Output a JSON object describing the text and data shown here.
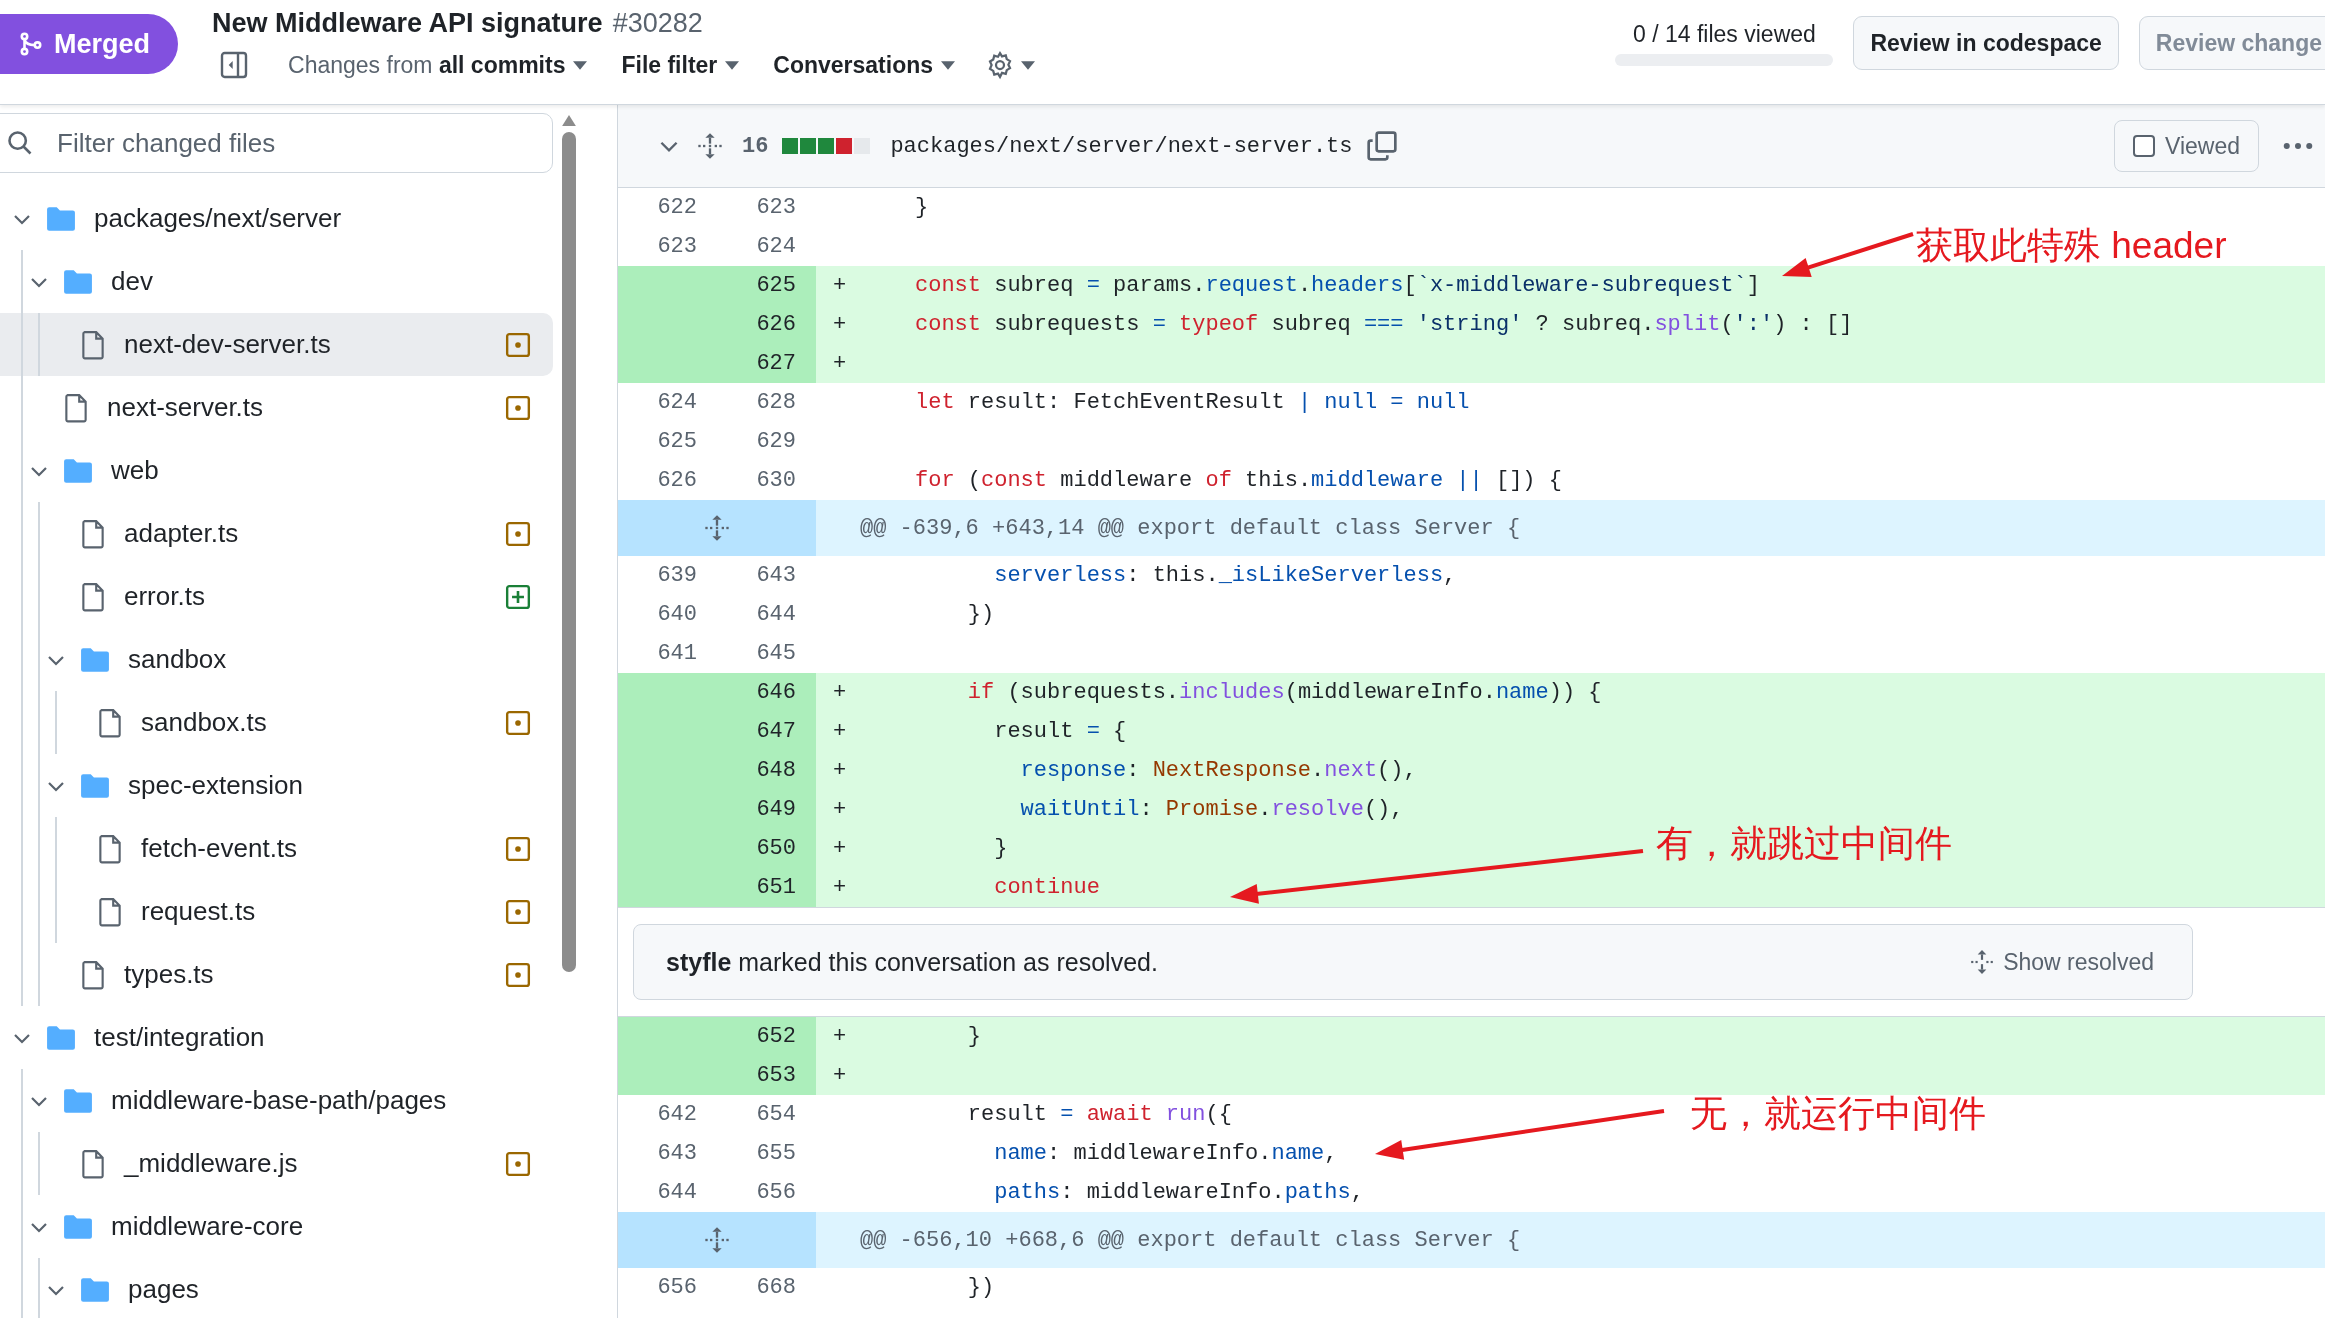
{
  "header": {
    "badge": {
      "kind": "merged",
      "label": "Merged"
    },
    "title": "New Middleware API signature",
    "number": "#30282",
    "filters": [
      {
        "label": "Changes from",
        "value": "all commits"
      },
      {
        "label": "File filter"
      },
      {
        "label": "Conversations"
      }
    ],
    "progress": {
      "text": "0 / 14 files viewed",
      "level": 0
    },
    "buttons": [
      {
        "label": "Review in codespace",
        "disabled": false
      },
      {
        "label": "Review change",
        "disabled": true
      }
    ]
  },
  "sidebar": {
    "search": {
      "placeholder": "Filter changed files"
    },
    "tree": [
      {
        "name": "packages/next/server",
        "kind": "folder",
        "expanded": true,
        "selected": false,
        "children": [
          {
            "name": "dev",
            "kind": "folder",
            "expanded": true,
            "selected": false,
            "children": [
              {
                "name": "next-dev-server.ts",
                "kind": "modified",
                "selected": true
              }
            ]
          },
          {
            "name": "next-server.ts",
            "kind": "modified",
            "selected": false
          },
          {
            "name": "web",
            "kind": "folder",
            "expanded": true,
            "selected": false,
            "children": [
              {
                "name": "adapter.ts",
                "kind": "modified",
                "selected": false
              },
              {
                "name": "error.ts",
                "kind": "added",
                "selected": false
              },
              {
                "name": "sandbox",
                "kind": "folder",
                "expanded": true,
                "selected": false,
                "children": [
                  {
                    "name": "sandbox.ts",
                    "kind": "modified",
                    "selected": false
                  }
                ]
              },
              {
                "name": "spec-extension",
                "kind": "folder",
                "expanded": true,
                "selected": false,
                "children": [
                  {
                    "name": "fetch-event.ts",
                    "kind": "modified",
                    "selected": false
                  },
                  {
                    "name": "request.ts",
                    "kind": "modified",
                    "selected": false
                  }
                ]
              },
              {
                "name": "types.ts",
                "kind": "modified",
                "selected": false
              }
            ]
          }
        ]
      },
      {
        "name": "test/integration",
        "kind": "folder",
        "expanded": true,
        "selected": false,
        "children": [
          {
            "name": "middleware-base-path/pages",
            "kind": "folder",
            "expanded": true,
            "selected": false,
            "children": [
              {
                "name": "_middleware.js",
                "kind": "modified",
                "selected": false
              }
            ]
          },
          {
            "name": "middleware-core",
            "kind": "folder",
            "expanded": true,
            "selected": false,
            "children": [
              {
                "name": "pages",
                "kind": "folder",
                "expanded": true,
                "selected": false
              }
            ]
          }
        ]
      }
    ]
  },
  "file": {
    "changes": "16",
    "diffstat": [
      {
        "kind": "added"
      },
      {
        "kind": "added"
      },
      {
        "kind": "added"
      },
      {
        "kind": "deleted"
      },
      {
        "kind": "neutral"
      }
    ],
    "path": "packages/next/server/next-server.ts",
    "viewed": false,
    "viewed_label": "Viewed",
    "rows": [
      {
        "kind": "context",
        "old": "622",
        "new": "623",
        "code": [
          {
            "text": "}"
          }
        ]
      },
      {
        "kind": "context",
        "old": "623",
        "new": "624"
      },
      {
        "kind": "added",
        "new": "625",
        "marker": "+",
        "code": [
          {
            "kind": "kw",
            "text": "const"
          },
          {
            "text": " subreq "
          },
          {
            "kind": "op",
            "text": "="
          },
          {
            "text": " params."
          },
          {
            "kind": "prop",
            "text": "request"
          },
          {
            "text": "."
          },
          {
            "kind": "prop",
            "text": "headers"
          },
          {
            "text": "["
          },
          {
            "kind": "str",
            "text": "`x-middleware-subrequest`"
          },
          {
            "text": "]"
          }
        ]
      },
      {
        "kind": "added",
        "new": "626",
        "marker": "+",
        "code": [
          {
            "kind": "kw",
            "text": "const"
          },
          {
            "text": " subrequests "
          },
          {
            "kind": "op",
            "text": "= "
          },
          {
            "kind": "kw",
            "text": "typeof"
          },
          {
            "text": " subreq "
          },
          {
            "kind": "op",
            "text": "=== "
          },
          {
            "kind": "str",
            "text": "'string'"
          },
          {
            "text": " ? subreq."
          },
          {
            "kind": "fn",
            "text": "split"
          },
          {
            "text": "("
          },
          {
            "kind": "str",
            "text": "':'"
          },
          {
            "text": ") : []"
          }
        ]
      },
      {
        "kind": "added",
        "new": "627",
        "marker": "+"
      },
      {
        "kind": "context",
        "old": "624",
        "new": "628",
        "code": [
          {
            "kind": "kw",
            "text": "let"
          },
          {
            "text": " result: FetchEventResult "
          },
          {
            "kind": "op",
            "text": "| null = null"
          }
        ]
      },
      {
        "kind": "context",
        "old": "625",
        "new": "629"
      },
      {
        "kind": "context",
        "old": "626",
        "new": "630",
        "code": [
          {
            "kind": "kw",
            "text": "for"
          },
          {
            "text": " ("
          },
          {
            "kind": "kw",
            "text": "const"
          },
          {
            "text": " middleware "
          },
          {
            "kind": "kw",
            "text": "of"
          },
          {
            "text": " this."
          },
          {
            "kind": "prop",
            "text": "middleware "
          },
          {
            "kind": "op",
            "text": "||"
          },
          {
            "text": " []) {"
          }
        ]
      },
      {
        "kind": "hunk",
        "text": "@@ -639,6 +643,14 @@ export default class Server {"
      },
      {
        "kind": "context",
        "old": "639",
        "new": "643",
        "code": [
          {
            "kind": "prop",
            "text": "      serverless"
          },
          {
            "text": ": this."
          },
          {
            "kind": "prop",
            "text": "_isLikeServerless"
          },
          {
            "text": ","
          }
        ]
      },
      {
        "kind": "context",
        "old": "640",
        "new": "644",
        "code": [
          {
            "text": "    })"
          }
        ]
      },
      {
        "kind": "context",
        "old": "641",
        "new": "645"
      },
      {
        "kind": "added",
        "new": "646",
        "marker": "+",
        "code": [
          {
            "kind": "kw",
            "text": "    if"
          },
          {
            "text": " (subrequests."
          },
          {
            "kind": "fn",
            "text": "includes"
          },
          {
            "text": "(middlewareInfo."
          },
          {
            "kind": "prop",
            "text": "name"
          },
          {
            "text": ")) {"
          }
        ]
      },
      {
        "kind": "added",
        "new": "647",
        "marker": "+",
        "code": [
          {
            "text": "      result "
          },
          {
            "kind": "op",
            "text": "="
          },
          {
            "text": " {"
          }
        ]
      },
      {
        "kind": "added",
        "new": "648",
        "marker": "+",
        "code": [
          {
            "kind": "prop",
            "text": "        response"
          },
          {
            "text": ": "
          },
          {
            "kind": "type",
            "text": "NextResponse"
          },
          {
            "text": "."
          },
          {
            "kind": "fn",
            "text": "next"
          },
          {
            "text": "(),"
          }
        ]
      },
      {
        "kind": "added",
        "new": "649",
        "marker": "+",
        "code": [
          {
            "kind": "prop",
            "text": "        waitUntil"
          },
          {
            "text": ": "
          },
          {
            "kind": "type",
            "text": "Promise"
          },
          {
            "text": "."
          },
          {
            "kind": "fn",
            "text": "resolve"
          },
          {
            "text": "(),"
          }
        ]
      },
      {
        "kind": "added",
        "new": "650",
        "marker": "+",
        "code": [
          {
            "text": "      }"
          }
        ]
      },
      {
        "kind": "added",
        "new": "651",
        "marker": "+",
        "code": [
          {
            "kind": "kw",
            "text": "      continue"
          }
        ]
      },
      {
        "kind": "comment",
        "text": "**styfle** marked this conversation as resolved.",
        "action": "Show resolved"
      },
      {
        "kind": "added",
        "new": "652",
        "marker": "+",
        "code": [
          {
            "text": "    }"
          }
        ]
      },
      {
        "kind": "added",
        "new": "653",
        "marker": "+"
      },
      {
        "kind": "context",
        "old": "642",
        "new": "654",
        "code": [
          {
            "text": "    result "
          },
          {
            "kind": "op",
            "text": "= "
          },
          {
            "kind": "kw",
            "text": "await "
          },
          {
            "kind": "fn",
            "text": "run"
          },
          {
            "text": "({"
          }
        ]
      },
      {
        "kind": "context",
        "old": "643",
        "new": "655",
        "code": [
          {
            "kind": "prop",
            "text": "      name"
          },
          {
            "text": ": middlewareInfo."
          },
          {
            "kind": "prop",
            "text": "name"
          },
          {
            "text": ","
          }
        ]
      },
      {
        "kind": "context",
        "old": "644",
        "new": "656",
        "code": [
          {
            "kind": "prop",
            "text": "      paths"
          },
          {
            "text": ": middlewareInfo."
          },
          {
            "kind": "prop",
            "text": "paths"
          },
          {
            "text": ","
          }
        ]
      },
      {
        "kind": "hunk",
        "text": "@@ -656,10 +668,6 @@ export default class Server {"
      },
      {
        "kind": "context",
        "old": "656",
        "new": "668",
        "code": [
          {
            "text": "    })"
          }
        ]
      }
    ]
  },
  "annotations": [
    {
      "text": "获取此特殊 header"
    },
    {
      "text": "有，就跳过中间件"
    },
    {
      "text": "无，就运行中间件"
    }
  ]
}
